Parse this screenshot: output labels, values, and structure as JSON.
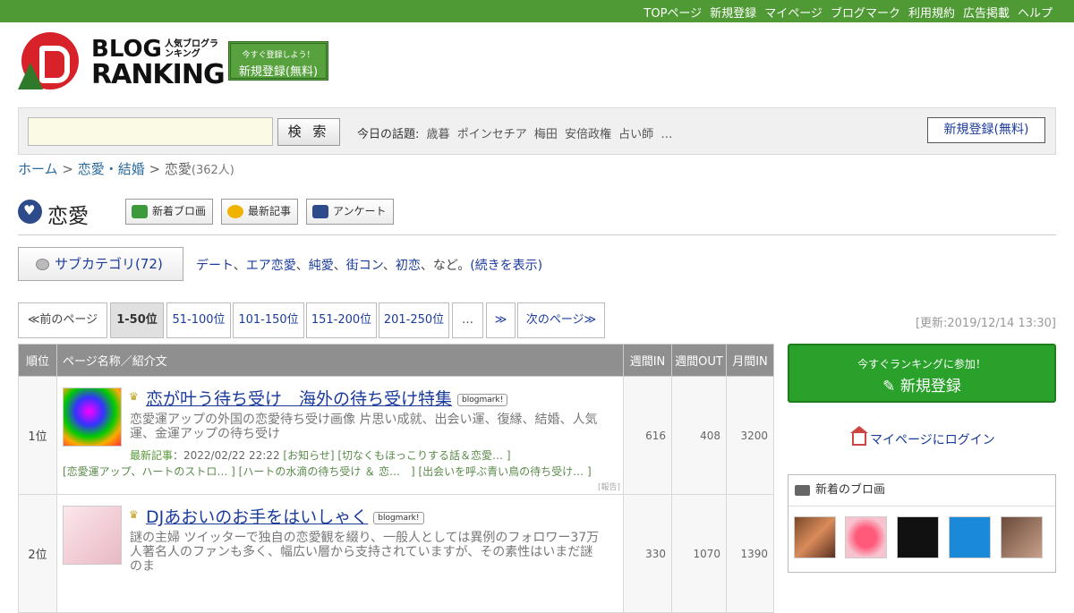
{
  "topnav": [
    "TOPページ",
    "新規登録",
    "マイページ",
    "ブログマーク",
    "利用規約",
    "広告掲載",
    "ヘルプ"
  ],
  "logo": {
    "line1": "BLOG",
    "line2": "RANKING",
    "tag": "人気ブログランキング"
  },
  "register_top": {
    "small": "今すぐ登録しよう！",
    "big": "新規登録(無料)"
  },
  "search": {
    "value": "",
    "button": "検 索"
  },
  "topics": {
    "label": "今日の話題:",
    "items": [
      "歳暮",
      "ポインセチア",
      "梅田",
      "安倍政権",
      "占い師",
      "…"
    ]
  },
  "register_free": "新規登録(無料)",
  "breadcrumb": {
    "home": "ホーム",
    "sep": ">",
    "parent": "恋愛・結婚",
    "current": "恋愛",
    "count": "(362人)"
  },
  "category": {
    "title": "恋愛",
    "buttons": [
      "新着ブロ画",
      "最新記事",
      "アンケート"
    ]
  },
  "subcategory": {
    "button": "サブカテゴリ(72)",
    "items": [
      "デート",
      "エア恋愛",
      "純愛",
      "街コン",
      "初恋"
    ],
    "suffix": "、など。",
    "more": "(続きを表示)"
  },
  "pager": {
    "prev": "≪前のページ",
    "pages": [
      "1-50位",
      "51-100位",
      "101-150位",
      "151-200位",
      "201-250位"
    ],
    "ellipsis": "…",
    "jump": "≫",
    "next": "次のページ≫"
  },
  "updated": "[更新:2019/12/14 13:30]",
  "table": {
    "headers": [
      "順位",
      "ページ名称／紹介文",
      "週間IN",
      "週間OUT",
      "月間IN"
    ],
    "rows": [
      {
        "rank": "1位",
        "title": "恋が叶う待ち受け　海外の待ち受け特集",
        "badge": "blogmark!",
        "desc": "恋愛運アップの外国の恋愛待ち受け画像 片思い成就、出会い運、復縁、結婚、人気運、金運アップの待ち受け",
        "latest_label": "最新記事",
        "latest_date": "：2022/02/22 22:22",
        "latest_links": [
          "[お知らせ]",
          "[切なくもほっこりする話＆恋愛… ]"
        ],
        "more_links": [
          "[恋愛運アップ、ハートのストロ… ]",
          "[ハートの水滴の待ち受け ＆ 恋…　]",
          "[出会いを呼ぶ青い鳥の待ち受け… ]"
        ],
        "report": "[報告]",
        "week_in": "616",
        "week_out": "408",
        "month_in": "3200"
      },
      {
        "rank": "2位",
        "title": "DJあおいのお手をはいしゃく",
        "badge": "blogmark!",
        "desc": "謎の主婦 ツイッターで独自の恋愛観を綴り、一般人としては異例のフォロワー37万人著名人のファンも多く、幅広い層から支持されていますが、その素性はいまだ謎のま",
        "week_in": "330",
        "week_out": "1070",
        "month_in": "1390"
      }
    ]
  },
  "sidebar": {
    "join_small": "今すぐランキングに参加！",
    "join_big": "新規登録",
    "login": "マイページにログイン",
    "new_images_title": "新着のブロ画"
  }
}
